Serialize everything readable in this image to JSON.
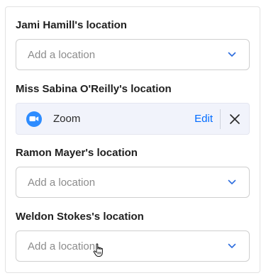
{
  "locations": [
    {
      "label": "Jami Hamill's location",
      "placeholder": "Add a location"
    },
    {
      "label": "Miss Sabina O'Reilly's location",
      "value": "Zoom",
      "edit_label": "Edit"
    },
    {
      "label": "Ramon Mayer's location",
      "placeholder": "Add a location"
    },
    {
      "label": "Weldon Stokes's location",
      "placeholder": "Add a location"
    }
  ],
  "colors": {
    "accent": "#006bff",
    "zoom_brand": "#2d8cff",
    "filled_background": "#f1f3fb"
  },
  "icons": {
    "dropdown": "chevron-down-icon",
    "zoom": "zoom-icon",
    "remove": "close-icon",
    "cursor": "hand-pointer-icon"
  }
}
